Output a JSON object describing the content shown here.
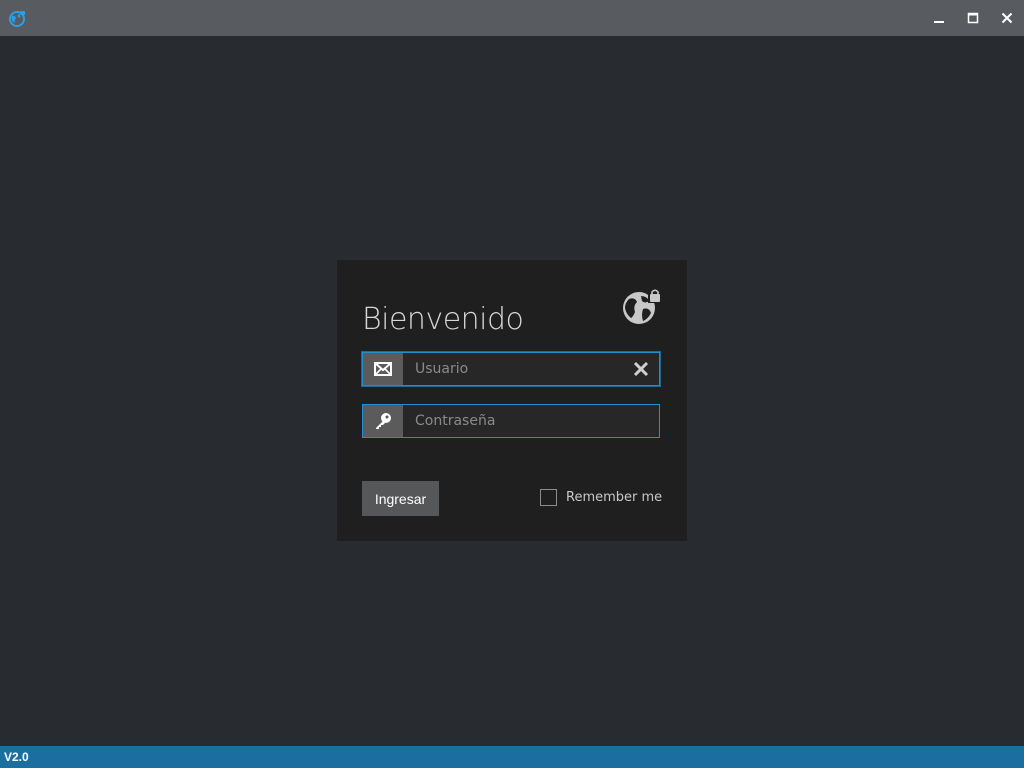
{
  "window": {
    "minimize_icon": "minimize-icon",
    "maximize_icon": "maximize-icon",
    "close_icon": "close-icon",
    "app_icon": "globe-icon"
  },
  "login": {
    "title": "Bienvenido",
    "logo_icon": "globe-lock-icon",
    "username": {
      "placeholder": "Usuario",
      "value": "",
      "icon": "envelope-icon",
      "clear_icon": "close-icon"
    },
    "password": {
      "placeholder": "Contraseña",
      "value": "",
      "icon": "key-icon"
    },
    "submit_label": "Ingresar",
    "remember_label": "Remember me",
    "remember_checked": false
  },
  "status": {
    "version": "V2.0"
  },
  "colors": {
    "background": "#282c30",
    "titlebar": "#585b60",
    "card": "#1f1f1f",
    "accent": "#1f8fcf",
    "statusbar": "#1a6fa0"
  }
}
